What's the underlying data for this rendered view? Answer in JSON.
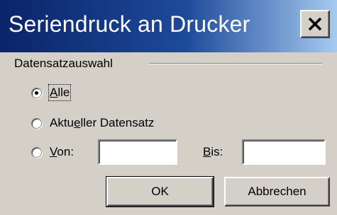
{
  "window": {
    "title": "Seriendruck an Drucker",
    "close_icon": "close-icon"
  },
  "group": {
    "label": "Datensatzauswahl"
  },
  "options": [
    {
      "label_pre": "",
      "label_mnemonic": "A",
      "label_post": "lle",
      "selected": true
    },
    {
      "label_pre": "Aktu",
      "label_mnemonic": "e",
      "label_post": "ller Datensatz",
      "selected": false
    },
    {
      "label_pre": "",
      "label_mnemonic": "V",
      "label_post": "on:",
      "selected": false
    }
  ],
  "range": {
    "from_value": "",
    "to_label_mnemonic": "B",
    "to_label_rest": "is:",
    "to_value": ""
  },
  "buttons": {
    "ok": "OK",
    "cancel": "Abbrechen"
  }
}
